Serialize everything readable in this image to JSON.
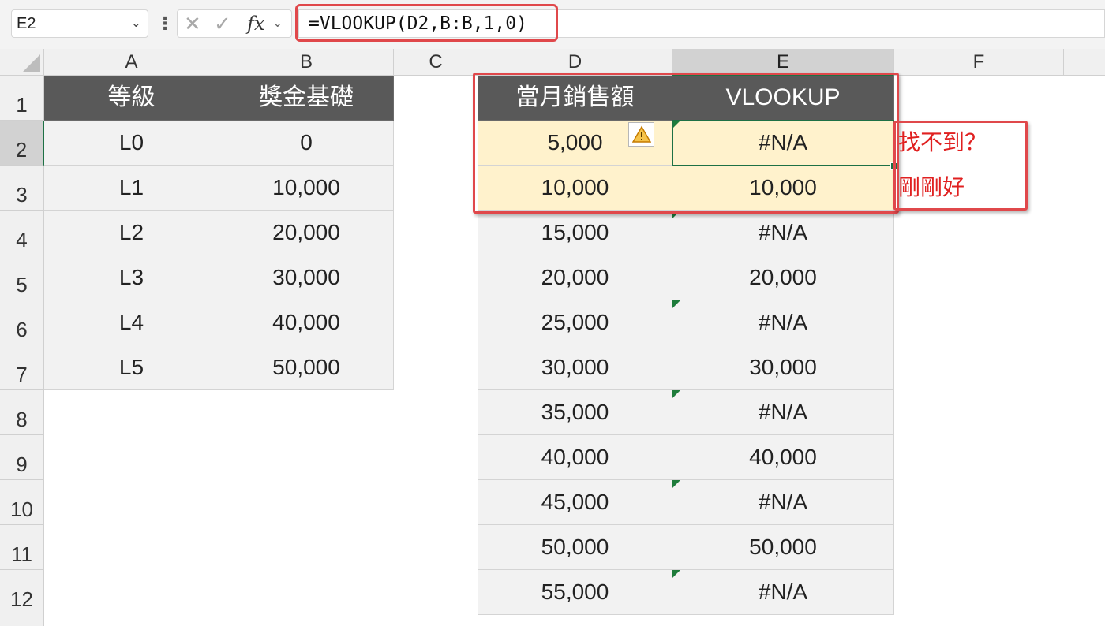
{
  "formula_bar": {
    "name_box": "E2",
    "formula": "=VLOOKUP(D2,B:B,1,0)",
    "icons": [
      "cancel-icon",
      "enter-icon",
      "function-icon"
    ]
  },
  "columns": [
    "A",
    "B",
    "C",
    "D",
    "E",
    "F"
  ],
  "rows": [
    "1",
    "2",
    "3",
    "4",
    "5",
    "6",
    "7",
    "8",
    "9",
    "10",
    "11",
    "12"
  ],
  "lookup_table": {
    "headers": [
      "等級",
      "獎金基礎"
    ],
    "rows": [
      [
        "L0",
        "0"
      ],
      [
        "L1",
        "10,000"
      ],
      [
        "L2",
        "20,000"
      ],
      [
        "L3",
        "30,000"
      ],
      [
        "L4",
        "40,000"
      ],
      [
        "L5",
        "50,000"
      ]
    ]
  },
  "sales_table": {
    "headers": [
      "當月銷售額",
      "VLOOKUP"
    ],
    "rows": [
      [
        "5,000",
        "#N/A"
      ],
      [
        "10,000",
        "10,000"
      ],
      [
        "15,000",
        "#N/A"
      ],
      [
        "20,000",
        "20,000"
      ],
      [
        "25,000",
        "#N/A"
      ],
      [
        "30,000",
        "30,000"
      ],
      [
        "35,000",
        "#N/A"
      ],
      [
        "40,000",
        "40,000"
      ],
      [
        "45,000",
        "#N/A"
      ],
      [
        "50,000",
        "50,000"
      ],
      [
        "55,000",
        "#N/A"
      ]
    ]
  },
  "notes": [
    "找不到？",
    "剛剛好"
  ],
  "colors": {
    "header_bg": "#595959",
    "highlight": "#e0484b",
    "selection": "#1e7145",
    "yellow_fill": "#fff2cc",
    "note_text": "#e02020"
  }
}
